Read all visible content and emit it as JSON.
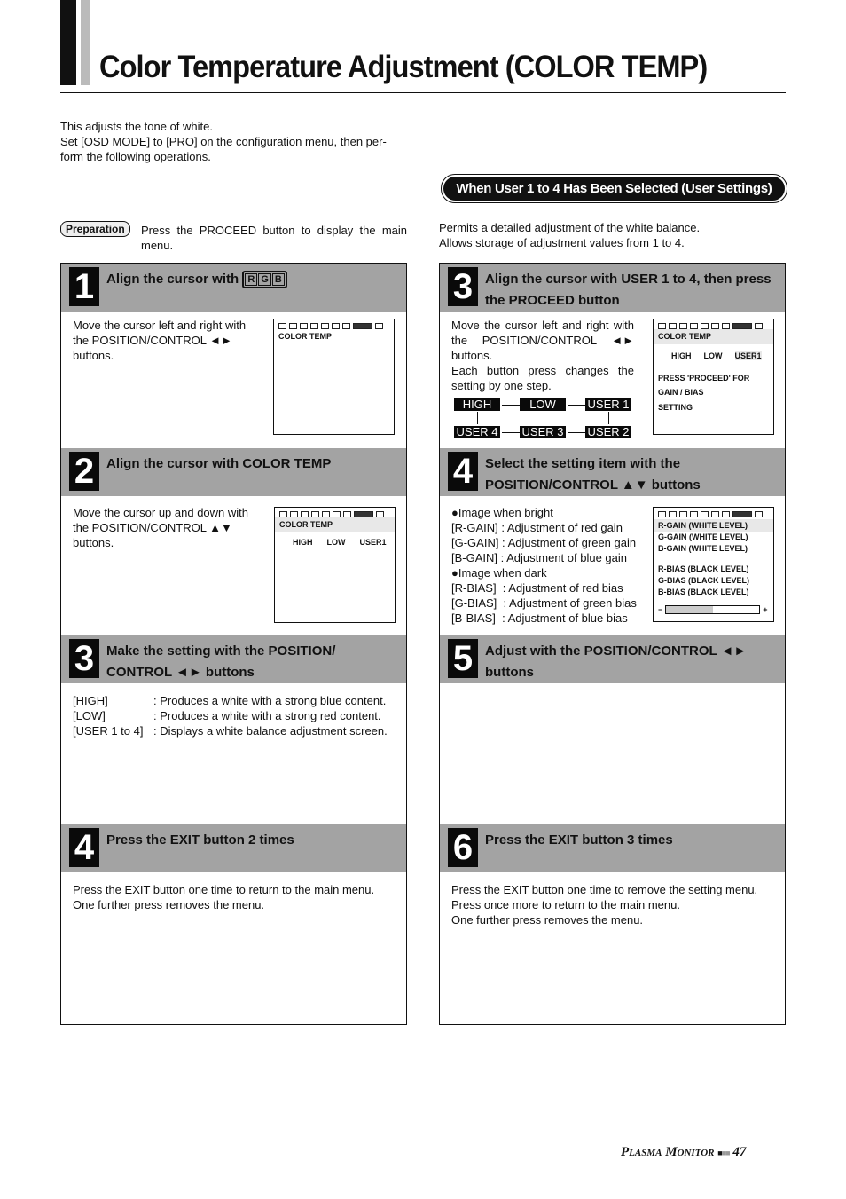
{
  "page": {
    "title": "Color Temperature Adjustment (COLOR TEMP)",
    "intro": [
      "This adjusts the tone of white.",
      "Set [OSD MODE] to [PRO] on the configuration menu, then per-",
      "form the following operations."
    ],
    "preparation_label": "Preparation",
    "preparation_text": "Press the PROCEED button to display the main menu.",
    "user_banner": "When User 1 to 4 Has Been Selected (User Settings)",
    "user_intro": [
      "Permits a detailed adjustment of the white balance.",
      "Allows storage of adjustment values from 1 to 4."
    ],
    "footer": {
      "brand": "Plasma Monitor",
      "page_number": "47"
    }
  },
  "left": {
    "s1": {
      "num": "1",
      "title": "Align the cursor with",
      "rgb": [
        "R",
        "G",
        "B"
      ],
      "body": "Move the cursor left and right with the POSITION/CONTROL ◄► buttons.",
      "screen": [
        "COLOR TEMP"
      ]
    },
    "s2": {
      "num": "2",
      "title": "Align the cursor with COLOR TEMP",
      "body": "Move the cursor up and down with the POSITION/CONTROL ▲▼ buttons.",
      "screen": [
        "COLOR TEMP"
      ],
      "options": [
        "HIGH",
        "LOW",
        "USER1"
      ]
    },
    "s3": {
      "num": "3",
      "title": "Make the setting with the POSITION/ CONTROL ◄► buttons",
      "rows": [
        [
          "[HIGH]",
          ": Produces a white with a strong blue content."
        ],
        [
          "[LOW]",
          ": Produces a white with a strong red content."
        ],
        [
          "[USER 1 to 4]",
          ": Displays a white balance adjustment screen."
        ]
      ]
    },
    "s4": {
      "num": "4",
      "title": "Press the EXIT button 2 times",
      "body": [
        "Press the EXIT button one time to return to the main menu.",
        "One further press removes the menu."
      ]
    }
  },
  "right": {
    "s3": {
      "num": "3",
      "title": "Align the cursor with USER 1 to 4, then press the PROCEED button",
      "body": [
        "Move the cursor left and right with the POSITION/CONTROL ◄► buttons.",
        "Each button press changes the setting by one step."
      ],
      "cycle": [
        "HIGH",
        "LOW",
        "USER 1",
        "USER 4",
        "USER 3",
        "USER 2"
      ],
      "screen": [
        "COLOR TEMP"
      ],
      "options": [
        "HIGH",
        "LOW",
        "USER1"
      ],
      "note": [
        "PRESS 'PROCEED' FOR",
        "GAIN / BIAS",
        "SETTING"
      ]
    },
    "s4": {
      "num": "4",
      "title": "Select the setting item with the POSITION/CONTROL ▲▼ buttons",
      "lines": [
        "●Image when bright",
        "[R-GAIN] : Adjustment of red gain",
        "[G-GAIN] : Adjustment of green gain",
        "[B-GAIN] : Adjustment of blue gain",
        "●Image when dark",
        "[R-BIAS]  : Adjustment of red bias",
        "[G-BIAS]  : Adjustment of green bias",
        "[B-BIAS]  : Adjustment of blue bias"
      ],
      "screen": [
        "R-GAIN (WHITE LEVEL)",
        "G-GAIN (WHITE LEVEL)",
        "B-GAIN (WHITE LEVEL)",
        "R-BIAS (BLACK LEVEL)",
        "G-BIAS (BLACK LEVEL)",
        "B-BIAS (BLACK LEVEL)"
      ],
      "minus": "−",
      "plus": "+",
      "level_percent": 50
    },
    "s5": {
      "num": "5",
      "title": "Adjust with the POSITION/CONTROL ◄►  buttons"
    },
    "s6": {
      "num": "6",
      "title": "Press the EXIT button 3 times",
      "body": [
        "Press the EXIT button one time to remove the setting menu.",
        "Press once more to return to the main menu.",
        "One further press removes the menu."
      ]
    }
  },
  "colors": {
    "header_gray": "#a3a3a3",
    "number_box": "#0a0a0a"
  }
}
